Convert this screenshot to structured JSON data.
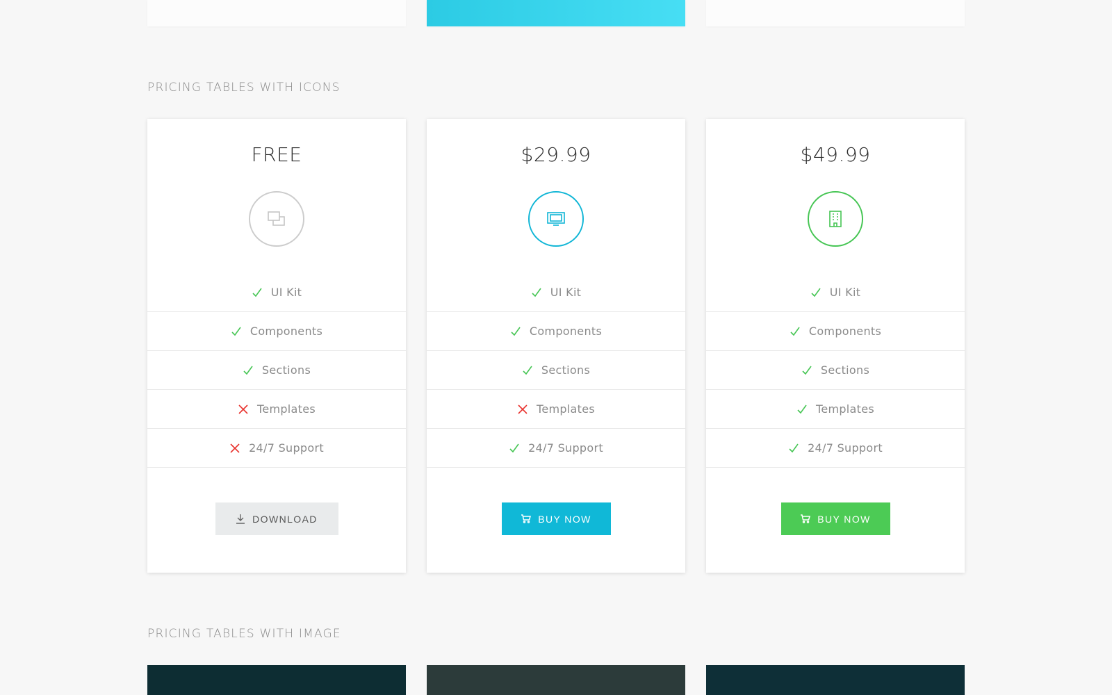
{
  "sections": {
    "icons_title": "PRICING TABLES WITH ICONS",
    "image_title": "PRICING TABLES WITH IMAGE"
  },
  "plans": [
    {
      "price": "FREE",
      "icon": "copy-icon",
      "accent": "#cccccc",
      "features": [
        {
          "label": "UI Kit",
          "included": true
        },
        {
          "label": "Components",
          "included": true
        },
        {
          "label": "Sections",
          "included": true
        },
        {
          "label": "Templates",
          "included": false
        },
        {
          "label": "24/7 Support",
          "included": false
        }
      ],
      "button_label": "DOWNLOAD",
      "button_icon": "download-icon"
    },
    {
      "price": "$29.99",
      "icon": "monitor-icon",
      "accent": "#11b6d6",
      "features": [
        {
          "label": "UI Kit",
          "included": true
        },
        {
          "label": "Components",
          "included": true
        },
        {
          "label": "Sections",
          "included": true
        },
        {
          "label": "Templates",
          "included": false
        },
        {
          "label": "24/7 Support",
          "included": true
        }
      ],
      "button_label": "BUY NOW",
      "button_icon": "cart-icon"
    },
    {
      "price": "$49.99",
      "icon": "building-icon",
      "accent": "#45c553",
      "features": [
        {
          "label": "UI Kit",
          "included": true
        },
        {
          "label": "Components",
          "included": true
        },
        {
          "label": "Sections",
          "included": true
        },
        {
          "label": "Templates",
          "included": true
        },
        {
          "label": "24/7 Support",
          "included": true
        }
      ],
      "button_label": "BUY NOW",
      "button_icon": "cart-icon"
    }
  ],
  "colors": {
    "check": "#45c553",
    "cross": "#e8342f",
    "gradient_card": "#2ccbe4"
  }
}
